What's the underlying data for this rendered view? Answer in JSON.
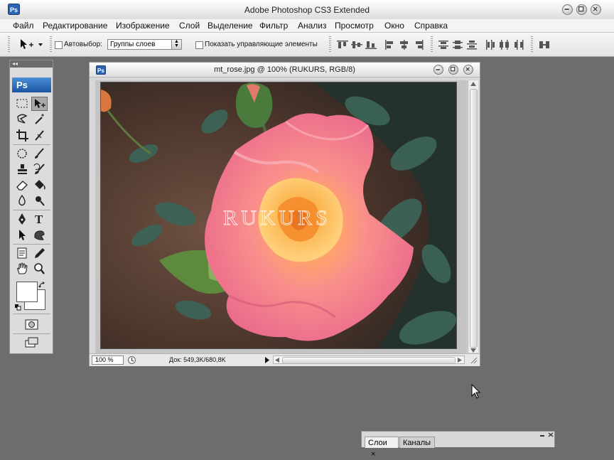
{
  "window": {
    "title": "Adobe Photoshop CS3 Extended",
    "app_icon": "ps-app-icon"
  },
  "menu": [
    "Файл",
    "Редактирование",
    "Изображение",
    "Слой",
    "Выделение",
    "Фильтр",
    "Анализ",
    "Просмотр",
    "Окно",
    "Справка"
  ],
  "options_bar": {
    "autoselect_label": "Автовыбор:",
    "autoselect_value": "Группы слоев",
    "show_controls_label": "Показать управляющие элементы"
  },
  "toolbox": {
    "collapse_glyph": "◂◂",
    "logo": "Ps"
  },
  "document": {
    "title": "mt_rose.jpg @ 100% (RUKURS, RGB/8)",
    "zoom": "100 %",
    "doc_info": "Док: 549,3K/680,8K",
    "watermark": "RUKURS"
  },
  "panels": {
    "layers_tab": "Слои",
    "channels_tab": "Каналы",
    "close_glyph": "×"
  },
  "colors": {
    "workspace_bg": "#6d6d6d",
    "ps_blue": "#1d56a4"
  }
}
